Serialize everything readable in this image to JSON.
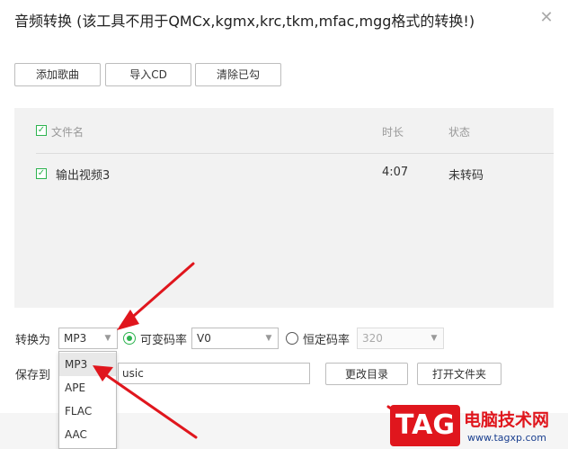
{
  "dialog": {
    "title": "音频转换 (该工具不用于QMCx,kgmx,krc,tkm,mfac,mgg格式的转换!)",
    "close_icon": "close-icon"
  },
  "toolbar": {
    "add_song": "添加歌曲",
    "import_cd": "导入CD",
    "clear_checked": "清除已勾"
  },
  "file_list": {
    "headers": {
      "filename": "文件名",
      "duration": "时长",
      "status": "状态"
    },
    "rows": [
      {
        "checked": true,
        "name": "输出视频3",
        "duration": "4:07",
        "status": "未转码"
      }
    ]
  },
  "convert": {
    "label": "转换为",
    "format_value": "MP3",
    "vbr_label": "可变码率",
    "vbr_value": "V0",
    "cbr_label": "恒定码率",
    "cbr_value": "320",
    "vbr_selected": true
  },
  "save": {
    "label": "保存到",
    "path_partial": "usic",
    "change_dir": "更改目录",
    "open_folder": "打开文件夹"
  },
  "format_dropdown": {
    "options": [
      "MP3",
      "APE",
      "FLAC",
      "AAC"
    ],
    "selected_index": 0
  },
  "watermark": {
    "tag": "TAG",
    "site_name": "电脑技术网",
    "url": "www.tagxp.com"
  },
  "colors": {
    "accent_green": "#2db34f",
    "arrow_red": "#e0161d",
    "list_bg": "#f2f2f2"
  }
}
